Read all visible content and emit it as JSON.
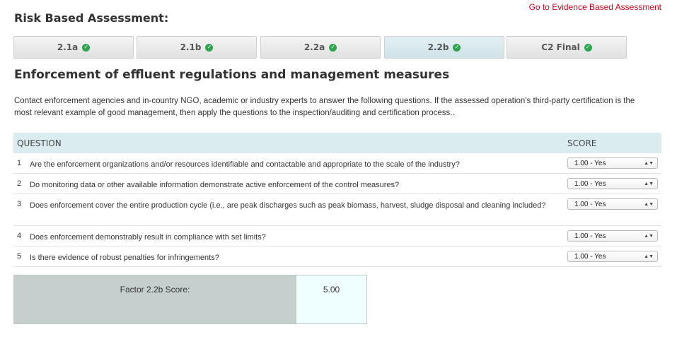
{
  "header": {
    "title": "Risk Based Assessment:",
    "evidence_link": "Go to Evidence Based Assessment"
  },
  "tabs": [
    {
      "label": "2.1a",
      "complete": true,
      "active": false
    },
    {
      "label": "2.1b",
      "complete": true,
      "active": false
    },
    {
      "label": "2.2a",
      "complete": true,
      "active": false
    },
    {
      "label": "2.2b",
      "complete": true,
      "active": true
    },
    {
      "label": "C2 Final",
      "complete": true,
      "active": false
    }
  ],
  "section": {
    "title": "Enforcement of effluent regulations and management measures",
    "intro": "Contact enforcement agencies and in-country NGO, academic or industry experts to answer the following questions. If the assessed operation's third-party certification is the most relevant example of good management, then apply the questions to the inspection/auditing and certification process.."
  },
  "table": {
    "question_header": "QUESTION",
    "score_header": "SCORE",
    "rows": [
      {
        "num": "1",
        "question": "Are the enforcement organizations and/or resources identifiable and contactable and appropriate to the scale of the industry?",
        "score": "1.00 - Yes"
      },
      {
        "num": "2",
        "question": "Do monitoring data or other available information demonstrate active enforcement of the control measures?",
        "score": "1.00 - Yes"
      },
      {
        "num": "3",
        "question": "Does enforcement cover the entire production cycle (i.e., are peak discharges such as peak biomass, harvest, sludge disposal and cleaning included?",
        "score": "1.00 - Yes"
      },
      {
        "num": "4",
        "question": "Does enforcement demonstrably result in compliance with set limits?",
        "score": "1.00 - Yes"
      },
      {
        "num": "5",
        "question": "Is there evidence of robust penalties for infringements?",
        "score": "1.00 - Yes"
      }
    ]
  },
  "factor": {
    "label": "Factor 2.2b Score:",
    "value": "5.00"
  },
  "colors": {
    "link": "#d0021b",
    "check": "#2ea44f",
    "table_header": "#dbecf0",
    "factor_label_bg": "#c5cfcd",
    "factor_value_bg": "#effefe"
  },
  "icons": {
    "check": "check-circle-icon",
    "select_arrow": "updown-arrow-icon"
  }
}
